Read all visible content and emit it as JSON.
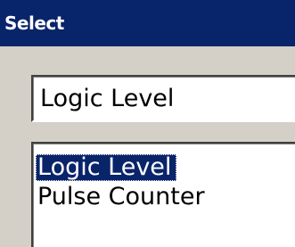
{
  "window": {
    "title": "Select"
  },
  "combo": {
    "value": "Logic Level"
  },
  "list": {
    "items": [
      {
        "label": "Logic Level",
        "selected": true
      },
      {
        "label": "Pulse Counter",
        "selected": false
      }
    ]
  },
  "colors": {
    "titlebar": "#08246b",
    "selection": "#0a246a",
    "face": "#d4d0c8"
  }
}
